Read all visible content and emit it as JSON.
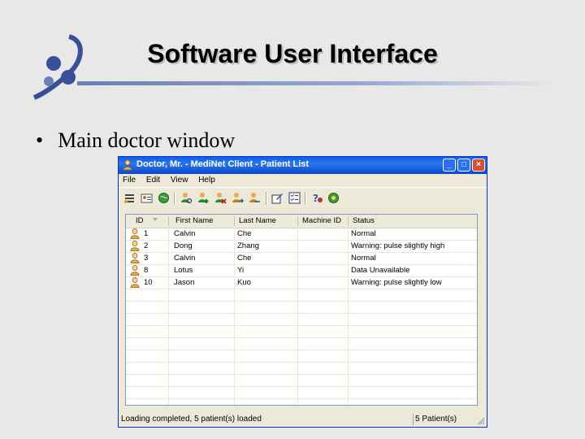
{
  "slide": {
    "title": "Software User Interface",
    "bullet": "Main doctor window",
    "bullet_symbol": "•"
  },
  "window": {
    "title": "Doctor, Mr. - MediNet Client - Patient List",
    "buttons": {
      "minimize": "_",
      "maximize": "□",
      "close": "×"
    }
  },
  "menu": [
    "File",
    "Edit",
    "View",
    "Help"
  ],
  "toolbar": {
    "icons": [
      "list-icon",
      "card-icon",
      "globe-icon",
      "user-search-icon",
      "user-add-icon",
      "user-remove-icon",
      "user-move-icon",
      "user-arrow-icon",
      "edit-icon",
      "checklist-icon",
      "help-icon",
      "settings-icon"
    ]
  },
  "table": {
    "columns": [
      "ID",
      "First Name",
      "Last Name",
      "Machine ID",
      "Status"
    ],
    "rows": [
      {
        "id": "1",
        "first": "Calvin",
        "last": "Che",
        "machine": "",
        "status": "Normal"
      },
      {
        "id": "2",
        "first": "Dong",
        "last": "Zhang",
        "machine": "",
        "status": "Warning: pulse slightly high"
      },
      {
        "id": "3",
        "first": "Calvin",
        "last": "Che",
        "machine": "",
        "status": "Normal"
      },
      {
        "id": "8",
        "first": "Lotus",
        "last": "Yi",
        "machine": "",
        "status": "Data Unavailable"
      },
      {
        "id": "10",
        "first": "Jason",
        "last": "Kuo",
        "machine": "",
        "status": "Warning: pulse slightly low"
      }
    ]
  },
  "status": {
    "left": "Loading completed, 5 patient(s) loaded",
    "right": "5 Patient(s)"
  },
  "colors": {
    "titlebar": "#0a5fe8",
    "window_bg": "#ece9d8",
    "slide_bg": "#e8e8e8"
  }
}
